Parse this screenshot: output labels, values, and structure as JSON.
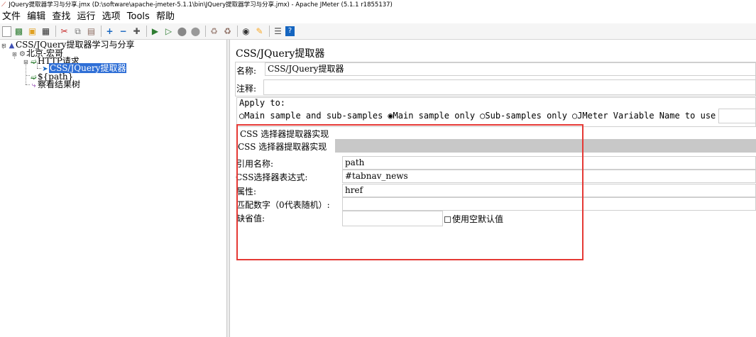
{
  "window": {
    "title": "JQuery提取器学习与分享.jmx (D:\\software\\apache-jmeter-5.1.1\\bin\\JQuery提取器学习与分享.jmx) - Apache JMeter (5.1.1 r1855137)"
  },
  "menu": [
    "文件",
    "编辑",
    "查找",
    "运行",
    "选项",
    "Tools",
    "帮助"
  ],
  "toolbar_icons": [
    "new-icon",
    "templates-icon",
    "open-icon",
    "save-icon",
    "cut-icon",
    "copy-icon",
    "paste-icon",
    "expand-icon",
    "collapse-icon",
    "toggle-icon",
    "start-icon",
    "start-no-pause-icon",
    "stop-icon",
    "shutdown-icon",
    "clear-icon",
    "clear-all-icon",
    "search-icon",
    "reset-search-icon",
    "function-helper-icon",
    "help-icon"
  ],
  "tree": {
    "root": "CSS/JQuery提取器学习与分享",
    "thread_group": "北京-宏哥",
    "http_request": "HTTP请求",
    "extractor": "CSS/JQuery提取器",
    "debug_var": "${path}",
    "result_tree": "察看结果树"
  },
  "panel": {
    "title": "CSS/JQuery提取器",
    "name_label": "名称:",
    "name_value": "CSS/JQuery提取器",
    "comment_label": "注释:",
    "comment_value": "",
    "apply_to": {
      "label": "Apply to:",
      "options": [
        "Main sample and sub-samples",
        "Main sample only",
        "Sub-samples only",
        "JMeter Variable Name to use"
      ],
      "selected": "Main sample only"
    },
    "impl_group_label": "CSS 选择器提取器实现",
    "impl_label": "CSS 选择器提取器实现",
    "impl_value": "",
    "ref_name_label": "引用名称:",
    "ref_name_value": "path",
    "css_expr_label": "CSS选择器表达式:",
    "css_expr_value": "#tabnav_news",
    "attr_label": "属性:",
    "attr_value": "href",
    "match_no_label": "匹配数字（0代表随机）:",
    "match_no_value": "",
    "default_label": "缺省值:",
    "default_value": "",
    "use_empty_default_label": "使用空默认值"
  },
  "colors": {
    "selection": "#2f6fd6",
    "highlight_box": "#e53935"
  }
}
